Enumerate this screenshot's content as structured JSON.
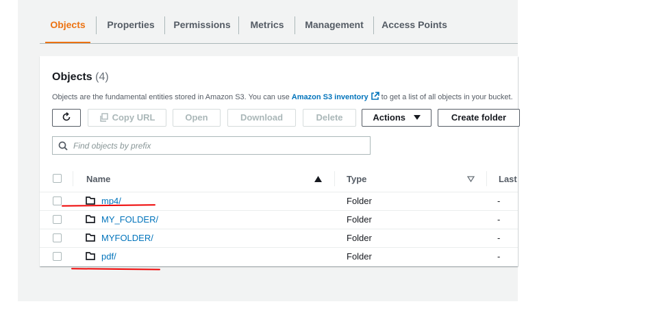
{
  "tabs": [
    {
      "label": "Objects",
      "active": true
    },
    {
      "label": "Properties",
      "active": false
    },
    {
      "label": "Permissions",
      "active": false
    },
    {
      "label": "Metrics",
      "active": false
    },
    {
      "label": "Management",
      "active": false
    },
    {
      "label": "Access Points",
      "active": false
    }
  ],
  "panel": {
    "title": "Objects",
    "count": "(4)",
    "description_prefix": "Objects are the fundamental entities stored in Amazon S3. You can use",
    "description_link": "Amazon S3 inventory",
    "description_suffix": "to get a list of all objects in your bucket."
  },
  "toolbar": {
    "refresh_icon": "refresh-icon",
    "copy_url_label": "Copy URL",
    "open_label": "Open",
    "download_label": "Download",
    "delete_label": "Delete",
    "actions_label": "Actions",
    "create_folder_label": "Create folder"
  },
  "search": {
    "placeholder": "Find objects by prefix",
    "value": ""
  },
  "table": {
    "columns": [
      "Name",
      "Type",
      "Last"
    ],
    "sort_column": "Name",
    "rows": [
      {
        "name": "mp4/",
        "type": "Folder",
        "last": "-",
        "annotated": true
      },
      {
        "name": "MY_FOLDER/",
        "type": "Folder",
        "last": "-",
        "annotated": false
      },
      {
        "name": "MYFOLDER/",
        "type": "Folder",
        "last": "-",
        "annotated": false
      },
      {
        "name": "pdf/",
        "type": "Folder",
        "last": "-",
        "annotated": true
      }
    ]
  },
  "colors": {
    "accent": "#ec7211",
    "link": "#0073bb",
    "annotation": "#e00000"
  }
}
